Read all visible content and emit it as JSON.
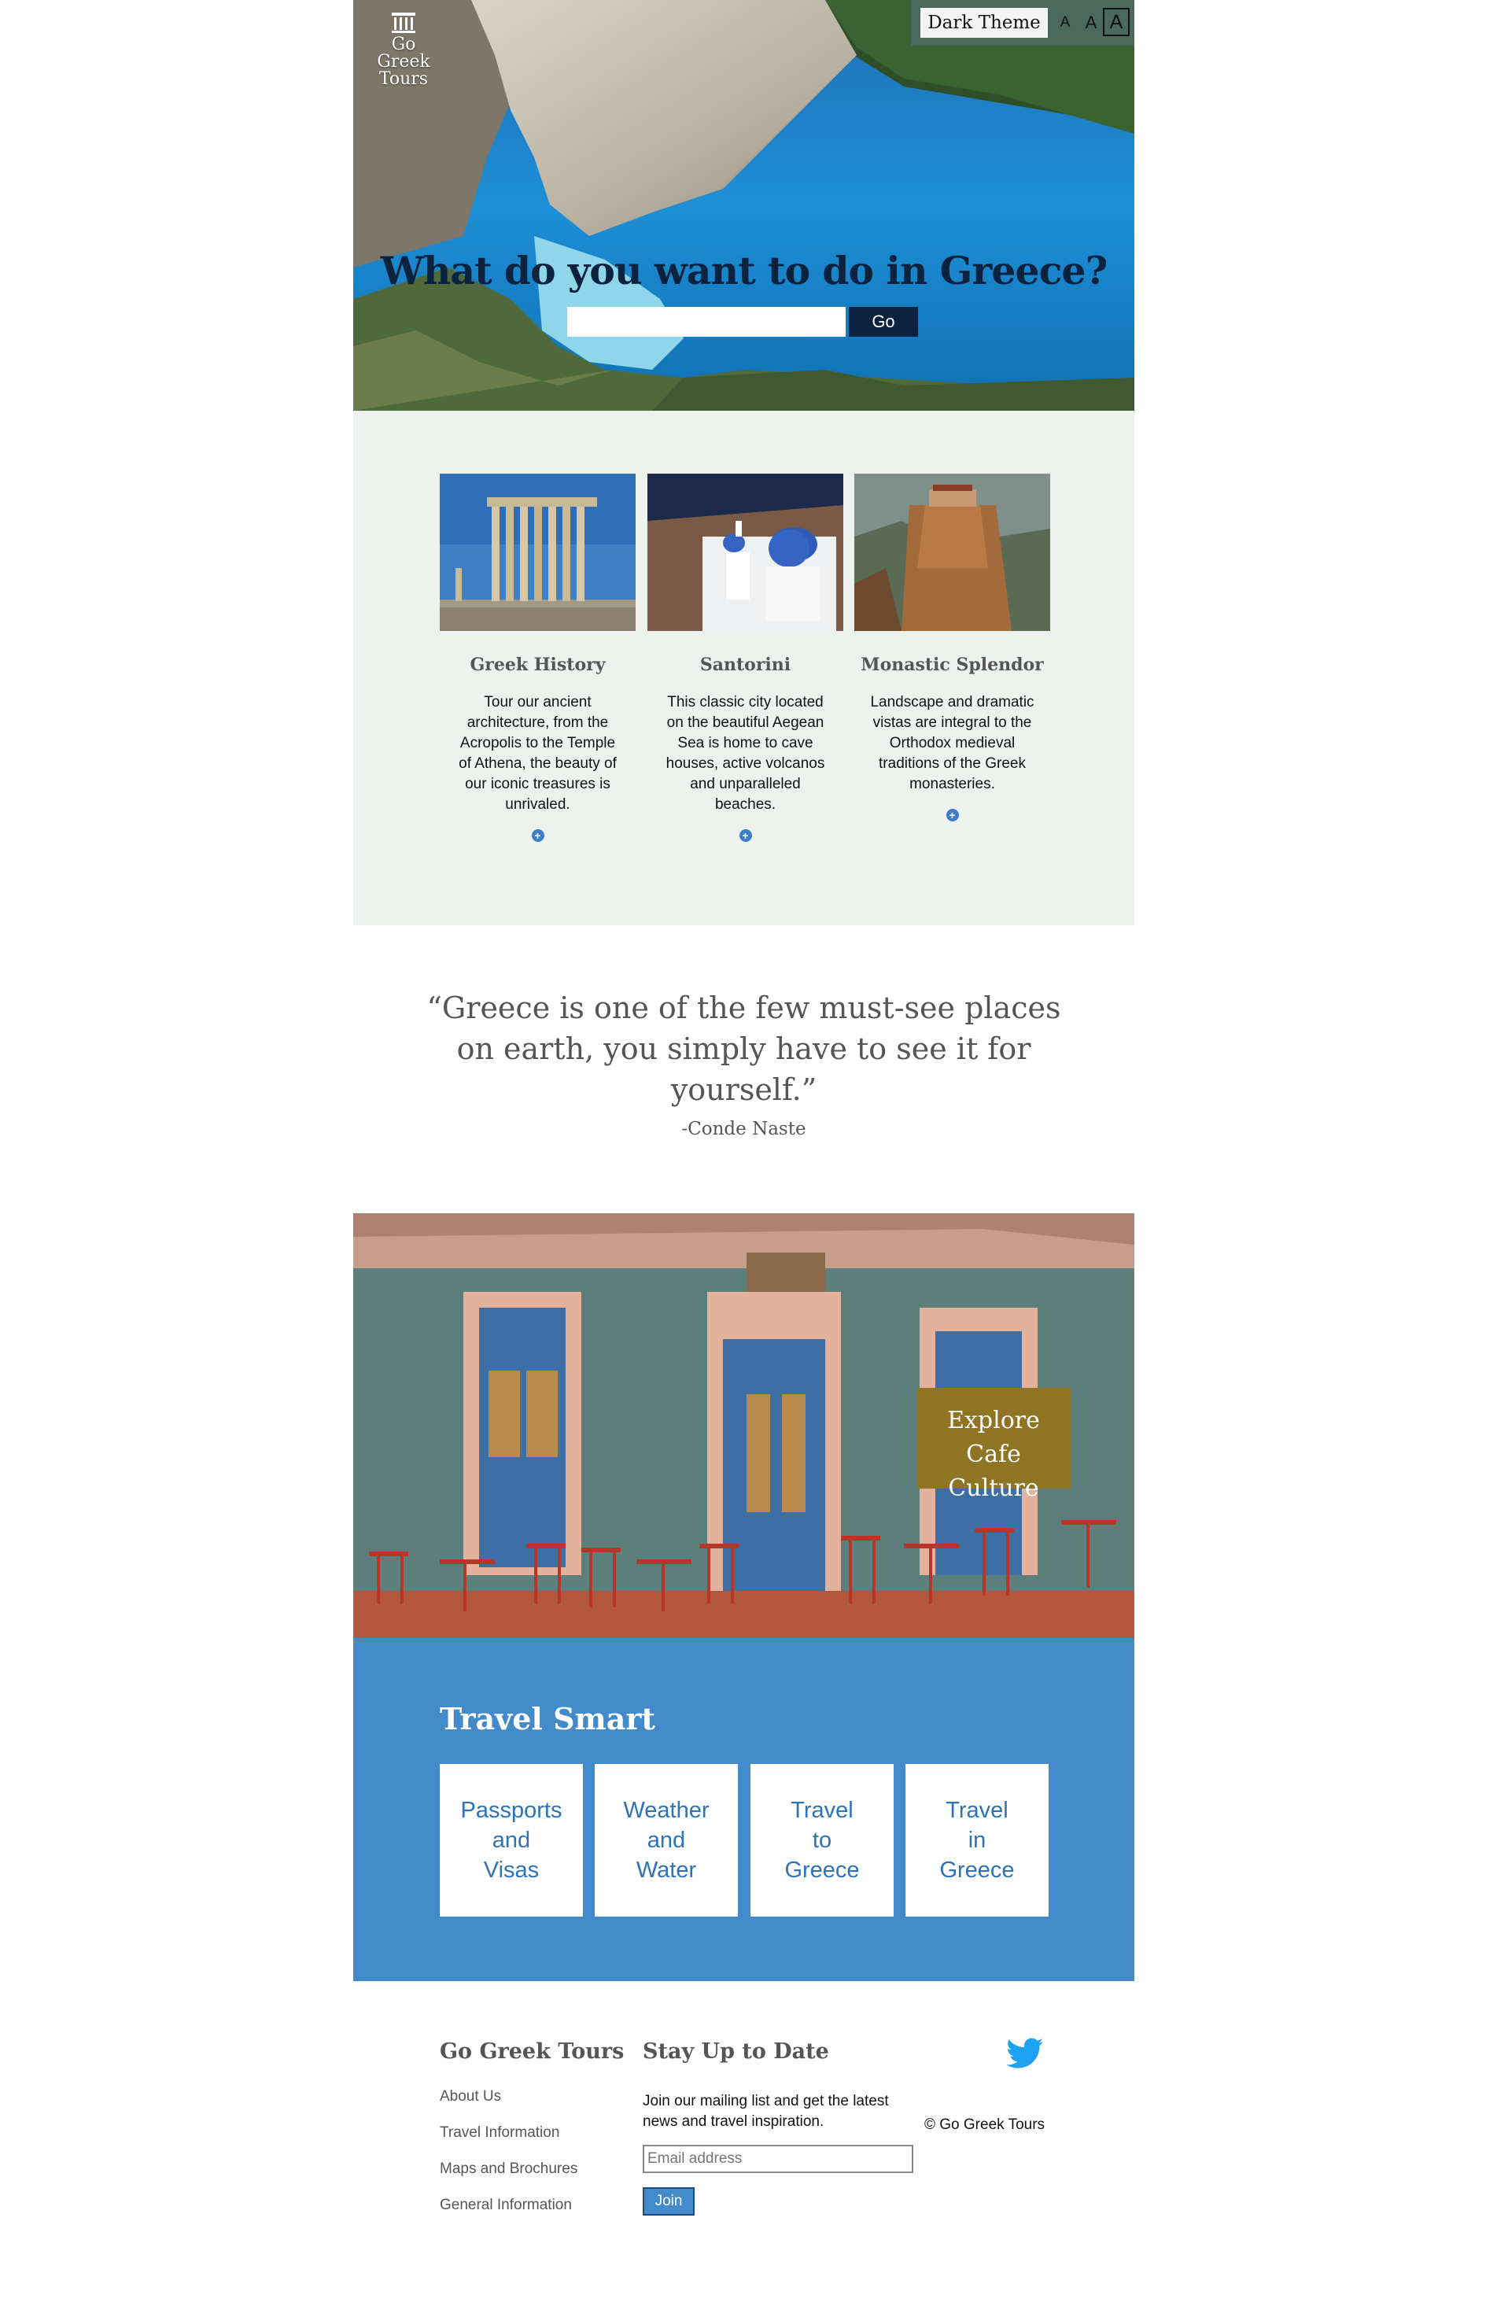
{
  "header": {
    "logo_text": "Go Greek Tours",
    "theme_button": "Dark Theme",
    "font_small": "A",
    "font_medium": "A",
    "font_large": "A"
  },
  "hero": {
    "title": "What do you want to do in Greece?",
    "search_placeholder": "",
    "go_label": "Go"
  },
  "cards": [
    {
      "title": "Greek History",
      "text": "Tour our ancient architecture, from the Acropolis to the Temple of Athena, the beauty of our iconic treasures is unrivaled.",
      "more": "+"
    },
    {
      "title": "Santorini",
      "text": "This classic city located on the beautiful Aegean Sea is home to cave houses, active volcanos and unparalleled beaches.",
      "more": "+"
    },
    {
      "title": "Monastic Splendor",
      "text": "Landscape and dramatic vistas are integral to the Orthodox medieval traditions of the Greek monasteries.",
      "more": "+"
    }
  ],
  "quote": {
    "text": "“Greece is one of the few must-see places on earth, you simply have to see it for yourself.”",
    "source": "-Conde Naste"
  },
  "cafe": {
    "cta_line1": "Explore Cafe",
    "cta_line2": "Culture"
  },
  "travel_smart": {
    "title": "Travel Smart",
    "tiles": [
      {
        "lines": [
          "Passports",
          "and",
          "Visas"
        ]
      },
      {
        "lines": [
          "Weather",
          "and",
          "Water"
        ]
      },
      {
        "lines": [
          "Travel",
          "to",
          "Greece"
        ]
      },
      {
        "lines": [
          "Travel",
          "in",
          "Greece"
        ]
      }
    ]
  },
  "footer": {
    "brand_title": "Go Greek Tours",
    "links": [
      "About Us",
      "Travel Information",
      "Maps and Brochures",
      "General Information"
    ],
    "newsletter_title": "Stay Up to Date",
    "newsletter_text": "Join our mailing list and get the latest news and travel inspiration.",
    "email_placeholder": "Email address",
    "join_label": "Join",
    "copyright": "© Go Greek Tours"
  },
  "colors": {
    "navy": "#0c2340",
    "card_bg": "#edf2ef",
    "smart_blue": "#438acb",
    "cafe_gold": "#8f7424",
    "twitter_blue": "#1da1f2"
  },
  "icons": {
    "logo": "column-temple-icon",
    "twitter": "twitter-bird-icon",
    "card_more": "plus-circle-icon"
  }
}
